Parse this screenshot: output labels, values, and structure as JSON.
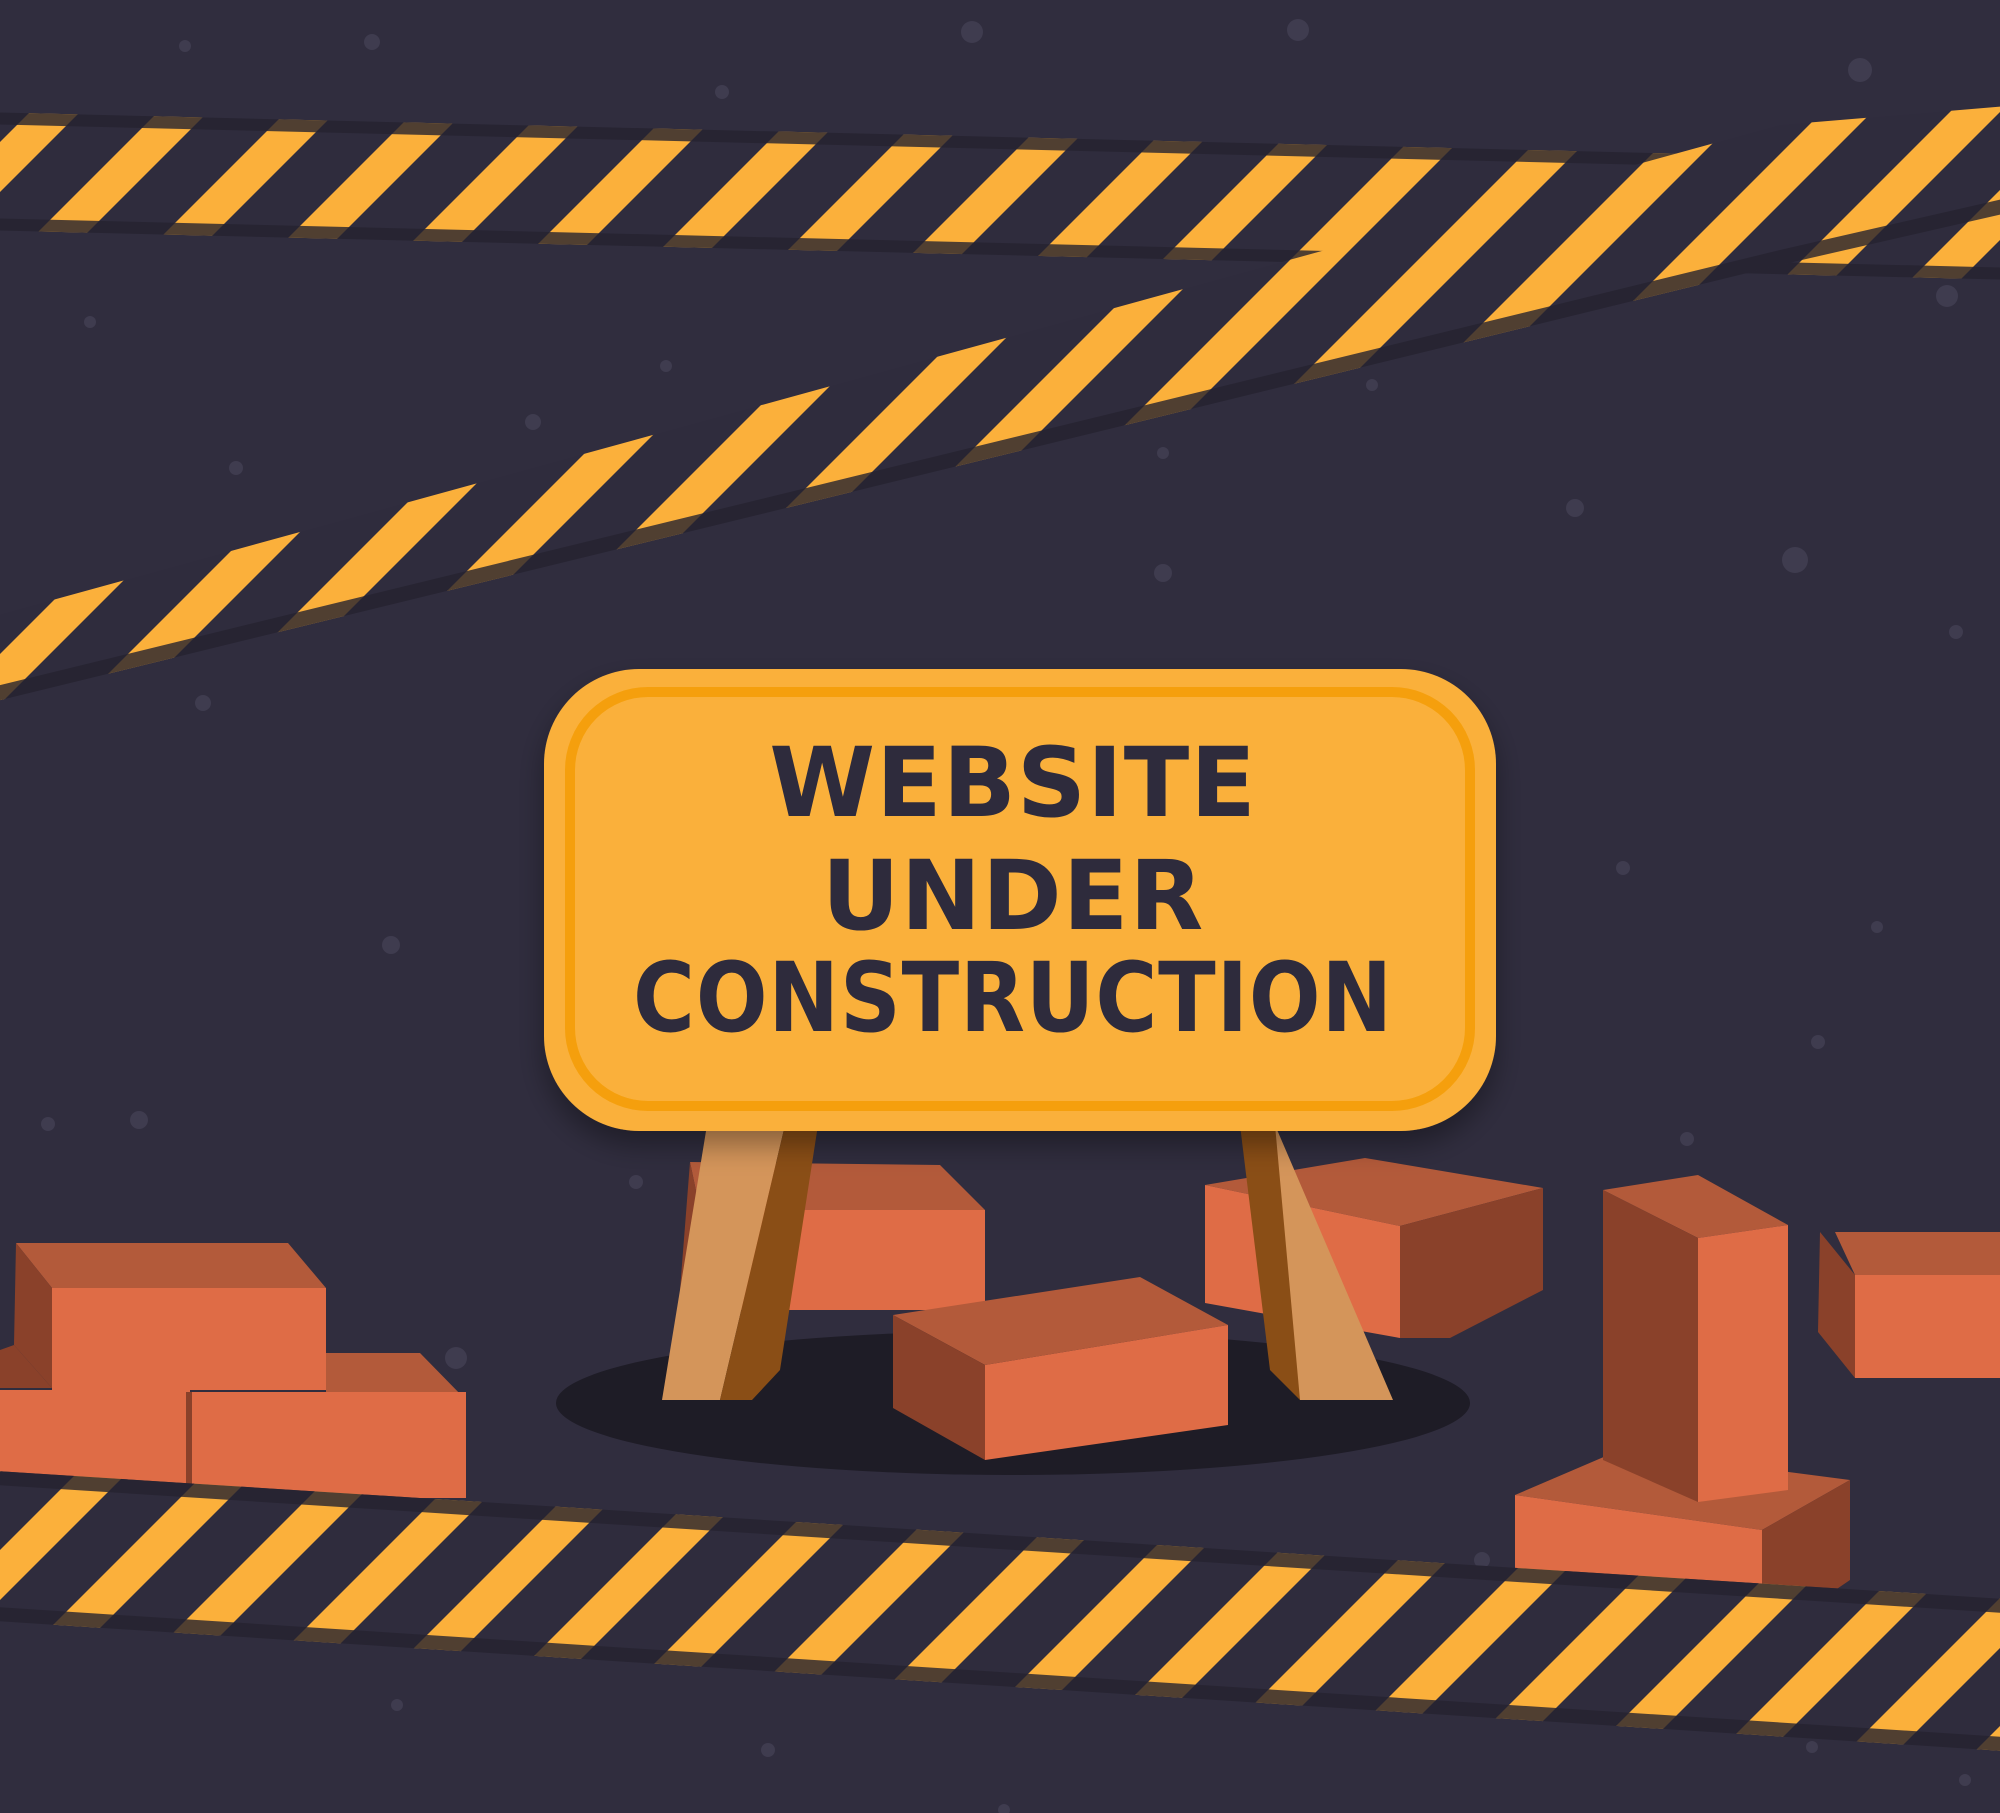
{
  "colors": {
    "background": "#302d3e",
    "tape_yellow": "#fbb03b",
    "tape_dark": "#2f2c3d",
    "sign_yellow": "#fab03a",
    "sign_border": "#f59f0b",
    "text_dark": "#2e2b3c",
    "brick_front": "#df6c46",
    "brick_top": "#b35a3a",
    "brick_side": "#8a412a",
    "wood_light": "#d4955a",
    "wood_dark": "#8a4e16",
    "shadow": "#1e1c26"
  },
  "sign": {
    "line1": "WEBSITE",
    "line2": "UNDER",
    "line3": "CONSTRUCTION"
  }
}
